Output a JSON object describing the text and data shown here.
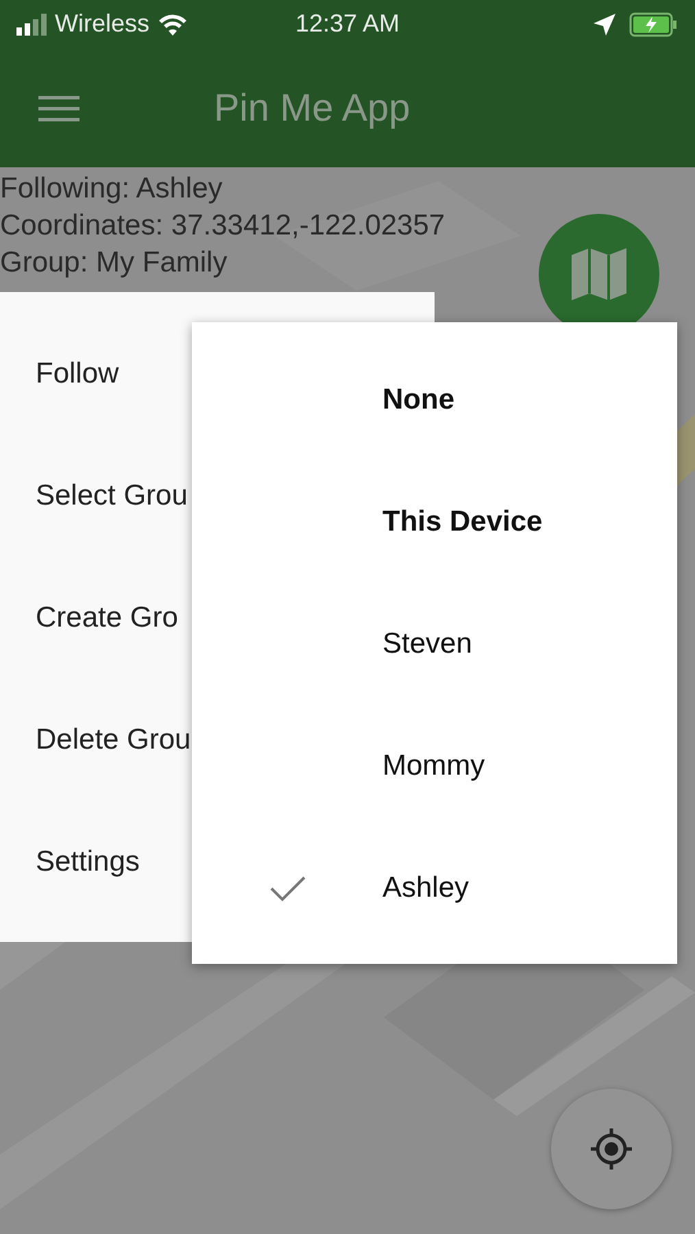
{
  "status_bar": {
    "carrier": "Wireless",
    "time": "12:37 AM"
  },
  "app_bar": {
    "title": "Pin Me App"
  },
  "info": [
    "Following: Ashley",
    "Coordinates: 37.33412,-122.02357",
    "Group: My Family"
  ],
  "menu": {
    "items": [
      "Follow",
      "Select Grou",
      "Create Gro",
      "Delete Grou",
      "Settings"
    ]
  },
  "submenu": {
    "items": [
      {
        "label": "None",
        "emphasized": true,
        "selected": false
      },
      {
        "label": "This Device",
        "emphasized": true,
        "selected": false
      },
      {
        "label": "Steven",
        "emphasized": false,
        "selected": false
      },
      {
        "label": "Mommy",
        "emphasized": false,
        "selected": false
      },
      {
        "label": "Ashley",
        "emphasized": false,
        "selected": true
      }
    ]
  }
}
